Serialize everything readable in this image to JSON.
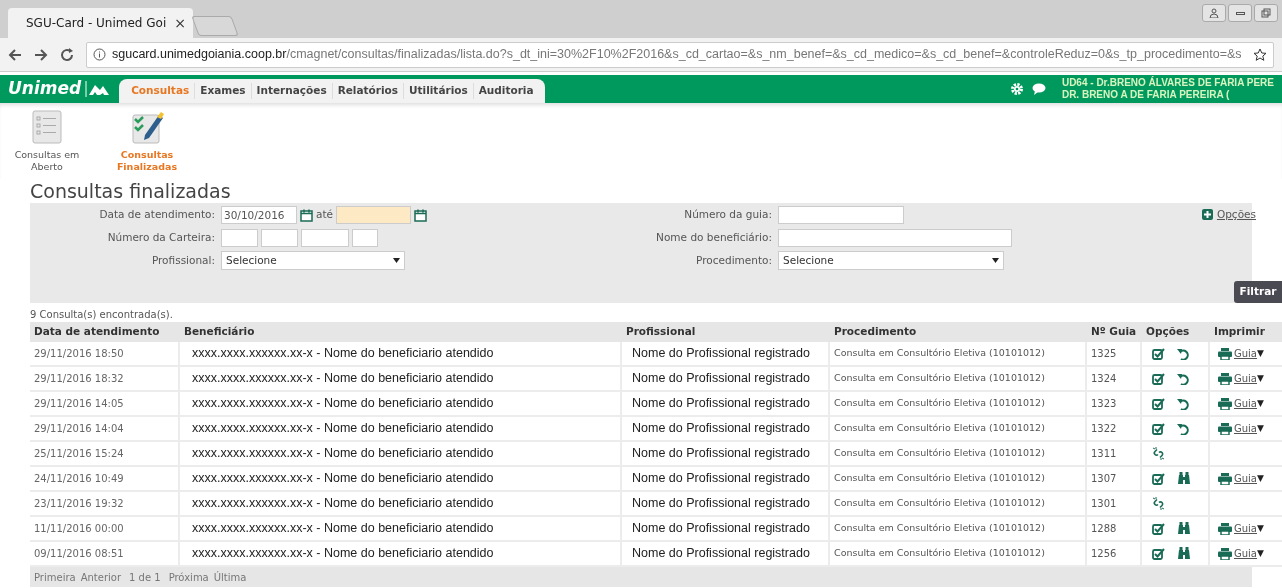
{
  "browser": {
    "tab_title": "SGU-Card - Unimed Goi",
    "tab_close": "×",
    "url_host": "sgucard.unimedgoiania.coop.br",
    "url_path": "/cmagnet/consultas/finalizadas/lista.do?s_dt_ini=30%2F10%2F2016&s_cd_cartao=&s_nm_benef=&s_cd_medico=&s_cd_benef=&controleReduz=0&s_tp_procedimento=&s"
  },
  "header": {
    "logo": "Unimed",
    "user_line_1": "UD64 - Dr.BRENO ÁLVARES DE FARIA PERE",
    "user_line_2": "DR. BRENO A DE FARIA PEREIRA ("
  },
  "nav": [
    {
      "label": "Consultas",
      "selected": true
    },
    {
      "label": "Exames",
      "selected": false
    },
    {
      "label": "Internações",
      "selected": false
    },
    {
      "label": "Relatórios",
      "selected": false
    },
    {
      "label": "Utilitários",
      "selected": false
    },
    {
      "label": "Auditoria",
      "selected": false
    }
  ],
  "shortcuts": [
    {
      "kind": "list",
      "label": "Consultas em Aberto",
      "selected": false
    },
    {
      "kind": "checklist",
      "label": "Consultas Finalizadas",
      "selected": true
    }
  ],
  "title": "Consultas finalizadas",
  "filters": {
    "date_label": "Data de atendimento:",
    "date_from": "30/10/2016",
    "date_sep": "até",
    "card_label": "Número da Carteira:",
    "professional_label": "Profissional:",
    "professional_value": "Selecione",
    "guide_label": "Número da guia:",
    "beneficiary_label": "Nome do beneficiário:",
    "procedure_label": "Procedimento:",
    "procedure_value": "Selecione",
    "options_link": "Opções",
    "filter_button": "Filtrar"
  },
  "result_count": "9 Consulta(s) encontrada(s).",
  "table": {
    "columns": [
      "Data de atendimento",
      "Beneficiário",
      "Profissional",
      "Procedimento",
      "Nº Guia",
      "Opções",
      "Imprimir"
    ],
    "rows": [
      {
        "date": "29/11/2016 18:50",
        "beneficiary": "xxxx.xxxx.xxxxxx.xx-x - Nome do beneficiario atendido",
        "professional": "Nome do Profissional registrado",
        "procedure": "Consulta em Consultório Eletiva (10101012)",
        "guide": "1325",
        "options": [
          {
            "kind": "check"
          },
          {
            "kind": "undo"
          }
        ],
        "print": "Guia"
      },
      {
        "date": "29/11/2016 18:32",
        "beneficiary": "xxxx.xxxx.xxxxxx.xx-x - Nome do beneficiario atendido",
        "professional": "Nome do Profissional registrado",
        "procedure": "Consulta em Consultório Eletiva (10101012)",
        "guide": "1324",
        "options": [
          {
            "kind": "check"
          },
          {
            "kind": "undo"
          }
        ],
        "print": "Guia"
      },
      {
        "date": "29/11/2016 14:05",
        "beneficiary": "xxxx.xxxx.xxxxxx.xx-x - Nome do beneficiario atendido",
        "professional": "Nome do Profissional registrado",
        "procedure": "Consulta em Consultório Eletiva (10101012)",
        "guide": "1323",
        "options": [
          {
            "kind": "check"
          },
          {
            "kind": "undo"
          }
        ],
        "print": "Guia"
      },
      {
        "date": "29/11/2016 14:04",
        "beneficiary": "xxxx.xxxx.xxxxxx.xx-x - Nome do beneficiario atendido",
        "professional": "Nome do Profissional registrado",
        "procedure": "Consulta em Consultório Eletiva (10101012)",
        "guide": "1322",
        "options": [
          {
            "kind": "check"
          },
          {
            "kind": "undo"
          }
        ],
        "print": "Guia"
      },
      {
        "date": "25/11/2016 15:24",
        "beneficiary": "xxxx.xxxx.xxxxxx.xx-x - Nome do beneficiario atendido",
        "professional": "Nome do Profissional registrado",
        "procedure": "Consulta em Consultório Eletiva (10101012)",
        "guide": "1311",
        "options": [
          {
            "kind": "unlink"
          }
        ]
      },
      {
        "date": "24/11/2016 10:49",
        "beneficiary": "xxxx.xxxx.xxxxxx.xx-x - Nome do beneficiario atendido",
        "professional": "Nome do Profissional registrado",
        "procedure": "Consulta em Consultório Eletiva (10101012)",
        "guide": "1307",
        "options": [
          {
            "kind": "check"
          },
          {
            "kind": "binoculars"
          }
        ],
        "print": "Guia"
      },
      {
        "date": "23/11/2016 19:32",
        "beneficiary": "xxxx.xxxx.xxxxxx.xx-x - Nome do beneficiario atendido",
        "professional": "Nome do Profissional registrado",
        "procedure": "Consulta em Consultório Eletiva (10101012)",
        "guide": "1301",
        "options": [
          {
            "kind": "unlink"
          }
        ]
      },
      {
        "date": "11/11/2016 00:00",
        "beneficiary": "xxxx.xxxx.xxxxxx.xx-x - Nome do beneficiario atendido",
        "professional": "Nome do Profissional registrado",
        "procedure": "Consulta em Consultório Eletiva (10101012)",
        "guide": "1288",
        "options": [
          {
            "kind": "check"
          },
          {
            "kind": "binoculars"
          }
        ],
        "print": "Guia"
      },
      {
        "date": "09/11/2016 08:51",
        "beneficiary": "xxxx.xxxx.xxxxxx.xx-x - Nome do beneficiario atendido",
        "professional": "Nome do Profissional registrado",
        "procedure": "Consulta em Consultório Eletiva (10101012)",
        "guide": "1256",
        "options": [
          {
            "kind": "check"
          },
          {
            "kind": "binoculars"
          }
        ],
        "print": "Guia"
      }
    ]
  },
  "pagination": [
    "Primeira",
    "Anterior",
    "1 de 1",
    "Próxima",
    "Última"
  ],
  "print_caret": "▼"
}
